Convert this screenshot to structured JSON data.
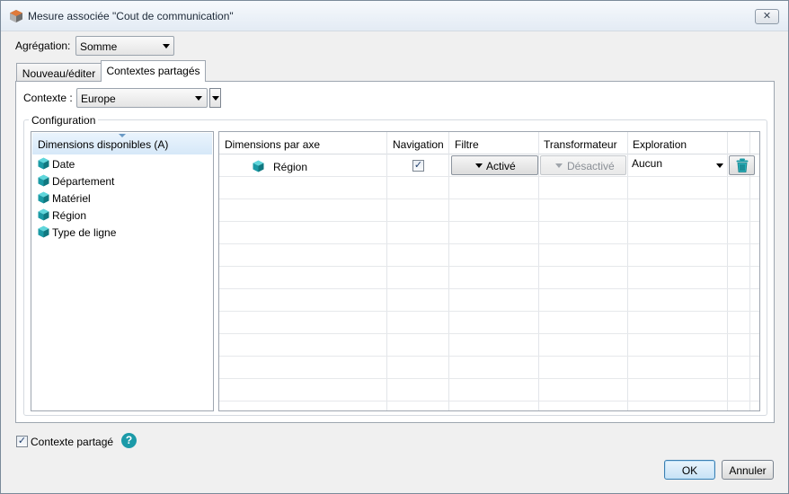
{
  "window": {
    "title": "Mesure associée \"Cout de communication\"",
    "close_symbol": "✕",
    "app_icon": "app-cube-icon"
  },
  "aggregation": {
    "label": "Agrégation:",
    "selected": "Somme"
  },
  "tabs": [
    {
      "label": "Nouveau/éditer",
      "active": false
    },
    {
      "label": "Contextes partagés",
      "active": true
    }
  ],
  "context": {
    "label": "Contexte :",
    "selected": "Europe"
  },
  "configuration": {
    "legend": "Configuration",
    "available": {
      "header": "Dimensions disponibles (A)",
      "items": [
        "Date",
        "Département",
        "Matériel",
        "Région",
        "Type de ligne"
      ]
    },
    "axis_table": {
      "columns": [
        "Dimensions par axe",
        "Navigation",
        "Filtre",
        "Transformateur",
        "Exploration"
      ],
      "rows": [
        {
          "dimension": "Région",
          "navigation_checked": true,
          "navigation_mark": "✓",
          "filtre": "Activé",
          "transformateur": "Désactivé",
          "exploration": "Aucun"
        }
      ]
    }
  },
  "footer": {
    "shared_checkbox_checked": true,
    "shared_checkbox_mark": "✓",
    "shared_label": "Contexte partagé",
    "help_symbol": "?",
    "ok": "OK",
    "cancel": "Annuler"
  },
  "colors": {
    "accent_teal": "#1b9aa8",
    "header_blue": "#d6e8f8",
    "ok_border": "#3c7fb1"
  }
}
